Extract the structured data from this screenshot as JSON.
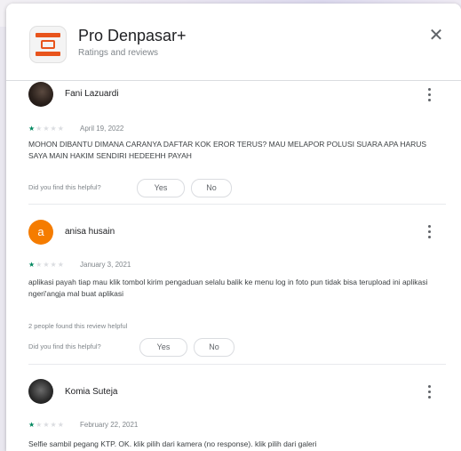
{
  "app": {
    "title": "Pro Denpasar+",
    "subtitle": "Ratings and reviews"
  },
  "labels": {
    "helpful_question": "Did you find this helpful?",
    "yes": "Yes",
    "no": "No"
  },
  "reviews": [
    {
      "name": "Fani Lazuardi",
      "rating": 1,
      "stars": "★",
      "stars_off": "★★★★",
      "date": "April 19, 2022",
      "text": "MOHON DIBANTU DIMANA CARANYA DAFTAR KOK EROR TERUS? MAU MELAPOR POLUSI SUARA APA HARUS SAYA MAIN HAKIM SENDIRI HEDEEHH PAYAH"
    },
    {
      "name": "anisa husain",
      "avatar_letter": "a",
      "rating": 1,
      "stars": "★",
      "stars_off": "★★★★",
      "date": "January 3, 2021",
      "text": "aplikasi payah tiap mau klik tombol kirim pengaduan selalu balik ke menu log in foto pun tidak bisa terupload ini aplikasi ngeri'angja mal buat aplikasi",
      "found_helpful": "2 people found this review helpful"
    },
    {
      "name": "Komia Suteja",
      "rating": 1,
      "stars": "★",
      "stars_off": "★★★★",
      "date": "February 22, 2021",
      "text": "Selfie sambil pegang KTP. OK. klik pilih dari kamera (no response). klik pilih dari galeri"
    }
  ]
}
